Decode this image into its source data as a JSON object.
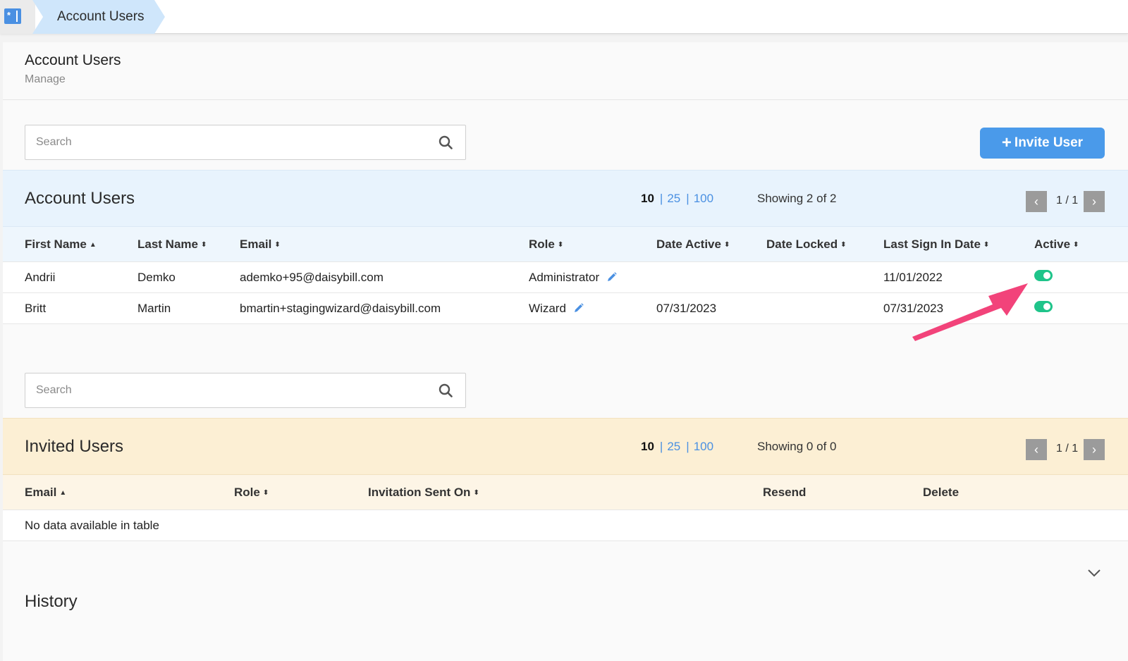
{
  "breadcrumb": {
    "label": "Account Users"
  },
  "page": {
    "title": "Account Users",
    "subtitle": "Manage"
  },
  "search": {
    "placeholder": "Search"
  },
  "invite_button": {
    "label": "Invite User"
  },
  "account_users": {
    "title": "Account Users",
    "page_sizes": [
      "10",
      "25",
      "100"
    ],
    "showing": "Showing 2 of 2",
    "pagination": "1 / 1",
    "columns": [
      "First Name",
      "Last Name",
      "Email",
      "Role",
      "Date Active",
      "Date Locked",
      "Last Sign In Date",
      "Active"
    ],
    "rows": [
      {
        "first": "Andrii",
        "last": "Demko",
        "email": "ademko+95@daisybill.com",
        "role": "Administrator",
        "date_active": "",
        "date_locked": "",
        "last_sign_in": "11/01/2022",
        "active": true
      },
      {
        "first": "Britt",
        "last": "Martin",
        "email": "bmartin+stagingwizard@daisybill.com",
        "role": "Wizard",
        "date_active": "07/31/2023",
        "date_locked": "",
        "last_sign_in": "07/31/2023",
        "active": true
      }
    ]
  },
  "invited_users": {
    "title": "Invited Users",
    "page_sizes": [
      "10",
      "25",
      "100"
    ],
    "showing": "Showing 0 of 0",
    "pagination": "1 / 1",
    "columns": [
      "Email",
      "Role",
      "Invitation Sent On",
      "Resend",
      "Delete"
    ],
    "empty_message": "No data available in table"
  },
  "history": {
    "title": "History"
  },
  "colors": {
    "accent": "#4a9aea",
    "account_section_bg": "#e8f3fd",
    "invited_section_bg": "#fcefd4",
    "toggle_on": "#1fc48a",
    "annotation_arrow": "#f2437a"
  }
}
